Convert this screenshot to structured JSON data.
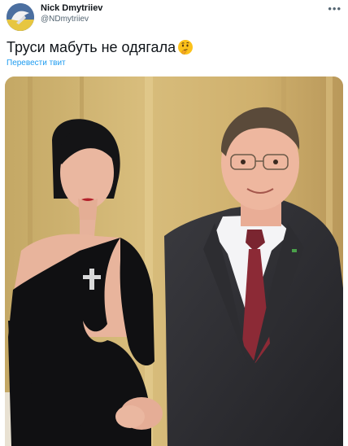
{
  "author": {
    "display_name": "Nick Dmytriiev",
    "handle": "@NDmytriiev"
  },
  "tweet": {
    "text": "Труси мабуть не одягала",
    "emoji": "thinking-face-icon",
    "translate_label": "Перевести твит"
  },
  "menu": {
    "more_icon": "more-horizontal-icon",
    "more_glyph": "•••"
  },
  "colors": {
    "accent": "#1d9bf0",
    "text": "#0f1419",
    "secondary": "#536471"
  }
}
